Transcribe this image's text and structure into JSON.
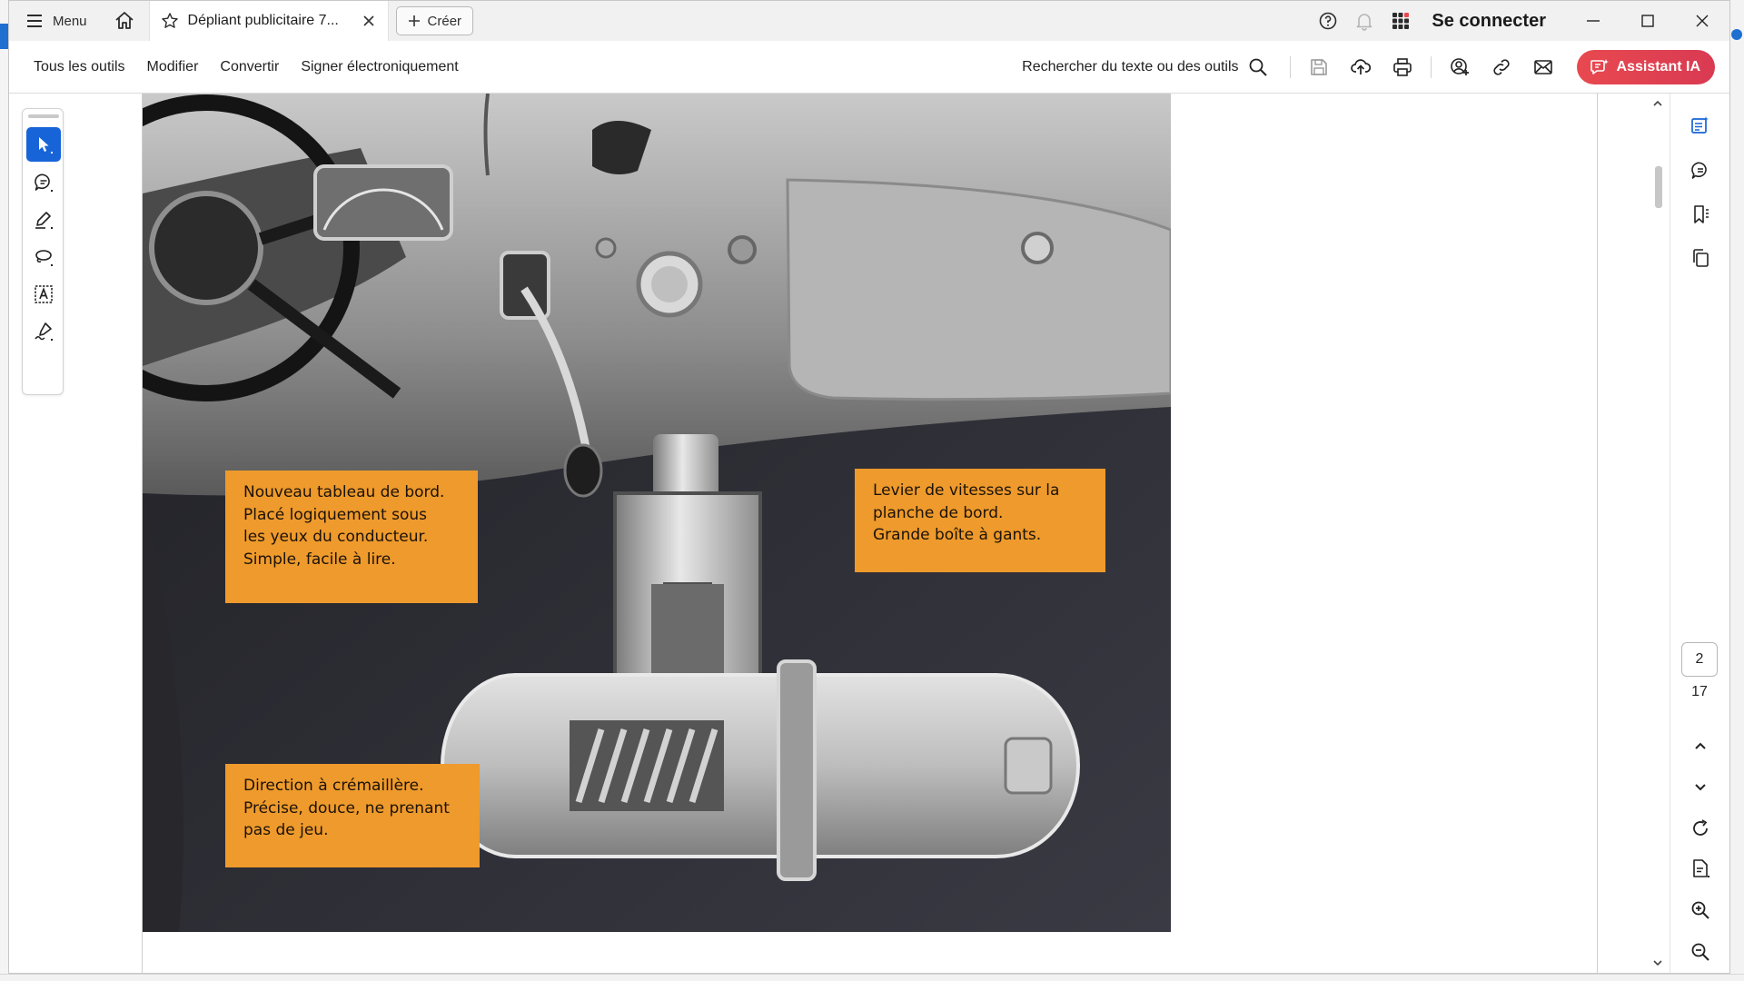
{
  "titlebar": {
    "menu_label": "Menu",
    "tab_title": "Dépliant publicitaire 7...",
    "create_label": "Créer",
    "signin_label": "Se connecter"
  },
  "toolbar": {
    "menus": [
      "Tous les outils",
      "Modifier",
      "Convertir",
      "Signer électroniquement"
    ],
    "search_label": "Rechercher du texte ou des outils",
    "ai_label": "Assistant IA"
  },
  "document": {
    "captions": {
      "dashboard": [
        "Nouveau tableau de bord.",
        "Placé logiquement sous",
        "les yeux du conducteur.",
        "Simple, facile à lire."
      ],
      "gearlever": [
        "Levier de vitesses sur la",
        "planche de bord.",
        "Grande boîte à gants."
      ],
      "steering": [
        "Direction à crémaillère.",
        "Précise, douce, ne prenant",
        "pas de jeu."
      ]
    }
  },
  "navigation": {
    "current_page": "2",
    "total_pages": "17"
  },
  "colors": {
    "accent_blue": "#1764d8",
    "ai_button": "#e8494f",
    "caption_orange": "#ee9a2c"
  }
}
